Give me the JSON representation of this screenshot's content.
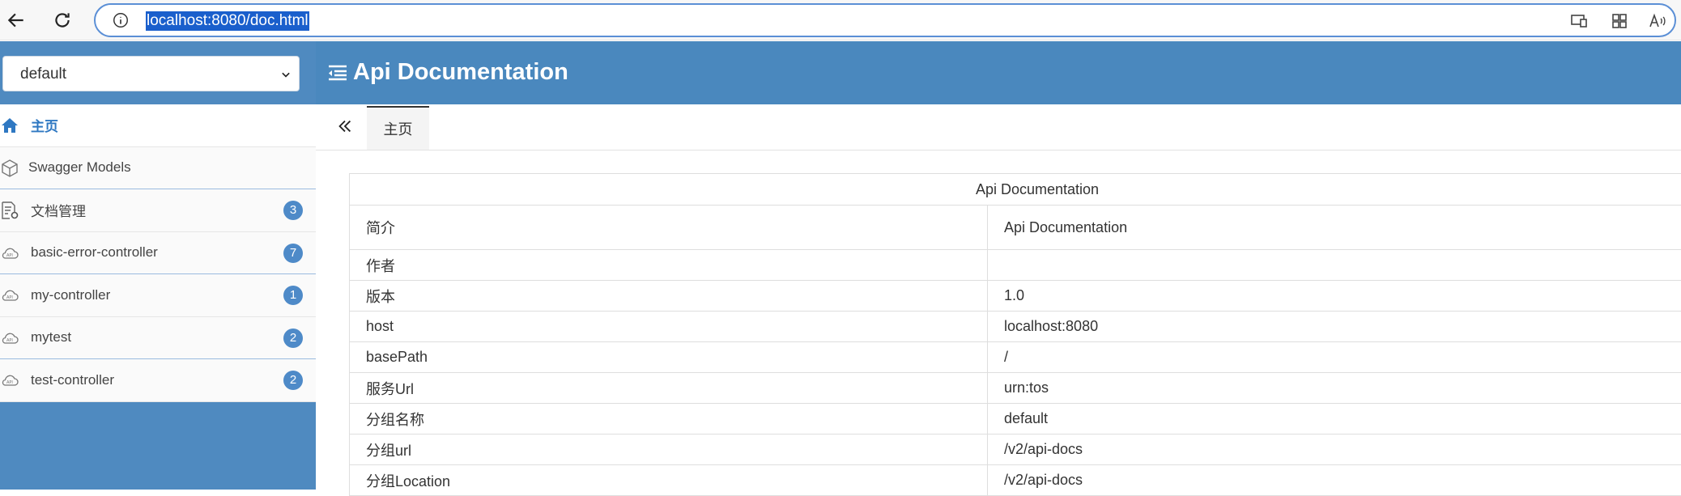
{
  "browser": {
    "url": "localhost:8080/doc.html"
  },
  "sidebar": {
    "group_select": "default",
    "items": [
      {
        "label": "主页",
        "icon": "home-icon",
        "badge": ""
      },
      {
        "label": "Swagger Models",
        "icon": "cube-icon",
        "badge": ""
      },
      {
        "label": "文档管理",
        "icon": "doc-settings-icon",
        "badge": "3"
      },
      {
        "label": "basic-error-controller",
        "icon": "api-cloud-icon",
        "badge": "7"
      },
      {
        "label": "my-controller",
        "icon": "api-cloud-icon",
        "badge": "1"
      },
      {
        "label": "mytest",
        "icon": "api-cloud-icon",
        "badge": "2"
      },
      {
        "label": "test-controller",
        "icon": "api-cloud-icon",
        "badge": "2"
      }
    ]
  },
  "header": {
    "title": "Api Documentation"
  },
  "tabs": [
    {
      "label": "主页"
    }
  ],
  "info_table": {
    "title": "Api Documentation",
    "rows": [
      {
        "key": "简介",
        "value": "Api Documentation"
      },
      {
        "key": "作者",
        "value": ""
      },
      {
        "key": "版本",
        "value": "1.0"
      },
      {
        "key": "host",
        "value": "localhost:8080"
      },
      {
        "key": "basePath",
        "value": "/"
      },
      {
        "key": "服务Url",
        "value": "urn:tos"
      },
      {
        "key": "分组名称",
        "value": "default"
      },
      {
        "key": "分组url",
        "value": "/v2/api-docs"
      },
      {
        "key": "分组Location",
        "value": "/v2/api-docs"
      }
    ]
  },
  "colors": {
    "accent": "#4a88be",
    "badge": "#4e8ac8",
    "active_text": "#2f78c2"
  }
}
